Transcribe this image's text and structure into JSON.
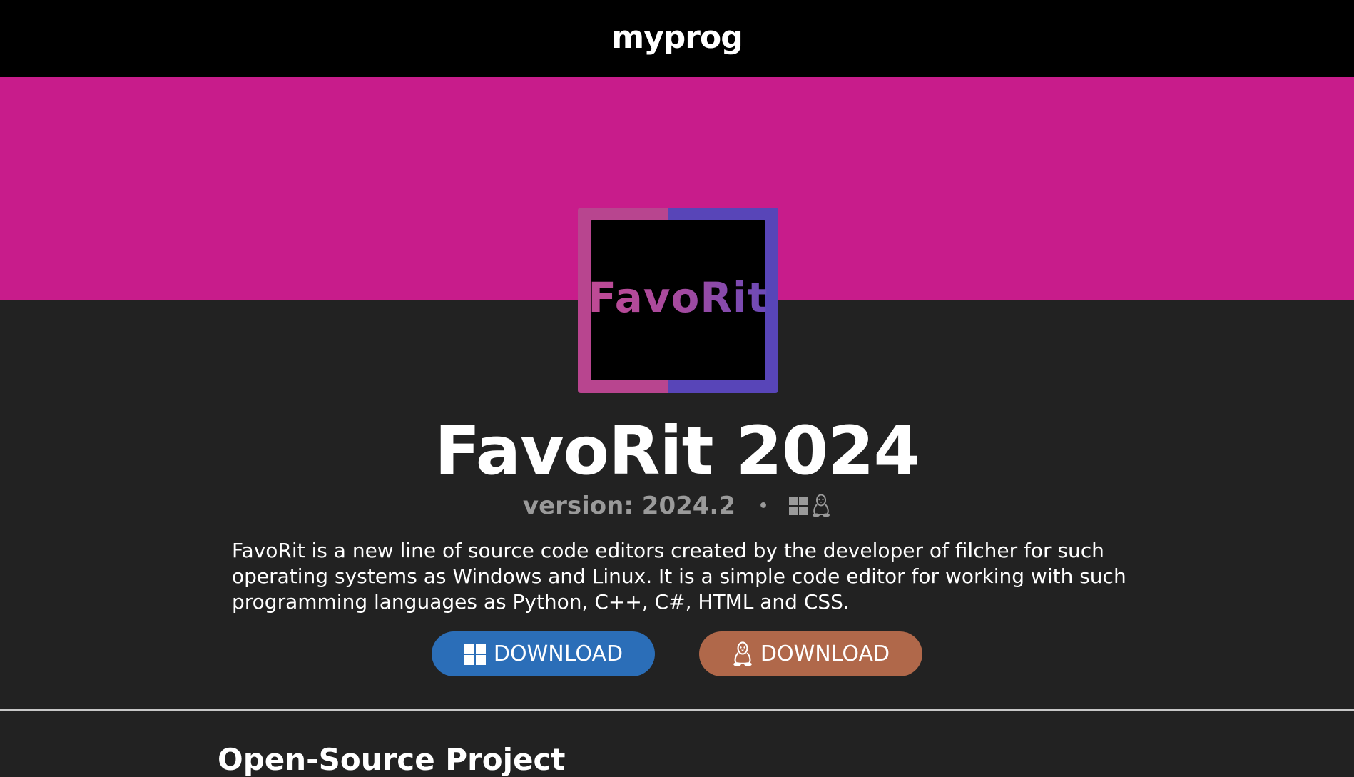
{
  "header": {
    "brand": "myprog"
  },
  "hero": {
    "logo_text": "FavoRit",
    "title": "FavoRit 2024",
    "version": "version: 2024.2",
    "separator": "•",
    "platform_icons": [
      "windows-icon",
      "linux-icon"
    ],
    "description": "FavoRit is a new line of source code editors created by the developer of filcher for such operating systems as Windows and Linux. It is a simple code editor for working with such programming languages as Python, C++, C#, HTML and CSS."
  },
  "downloads": [
    {
      "label": "DOWNLOAD",
      "icon": "windows-icon",
      "color": "#2b6eb8"
    },
    {
      "label": "DOWNLOAD",
      "icon": "linux-icon",
      "color": "#b0684a"
    }
  ],
  "section": {
    "title": "Open-Source Project"
  },
  "colors": {
    "topbar": "#000000",
    "banner": "#c81c8b",
    "background": "#222222",
    "windows_button": "#2b6eb8",
    "linux_button": "#b0684a"
  }
}
